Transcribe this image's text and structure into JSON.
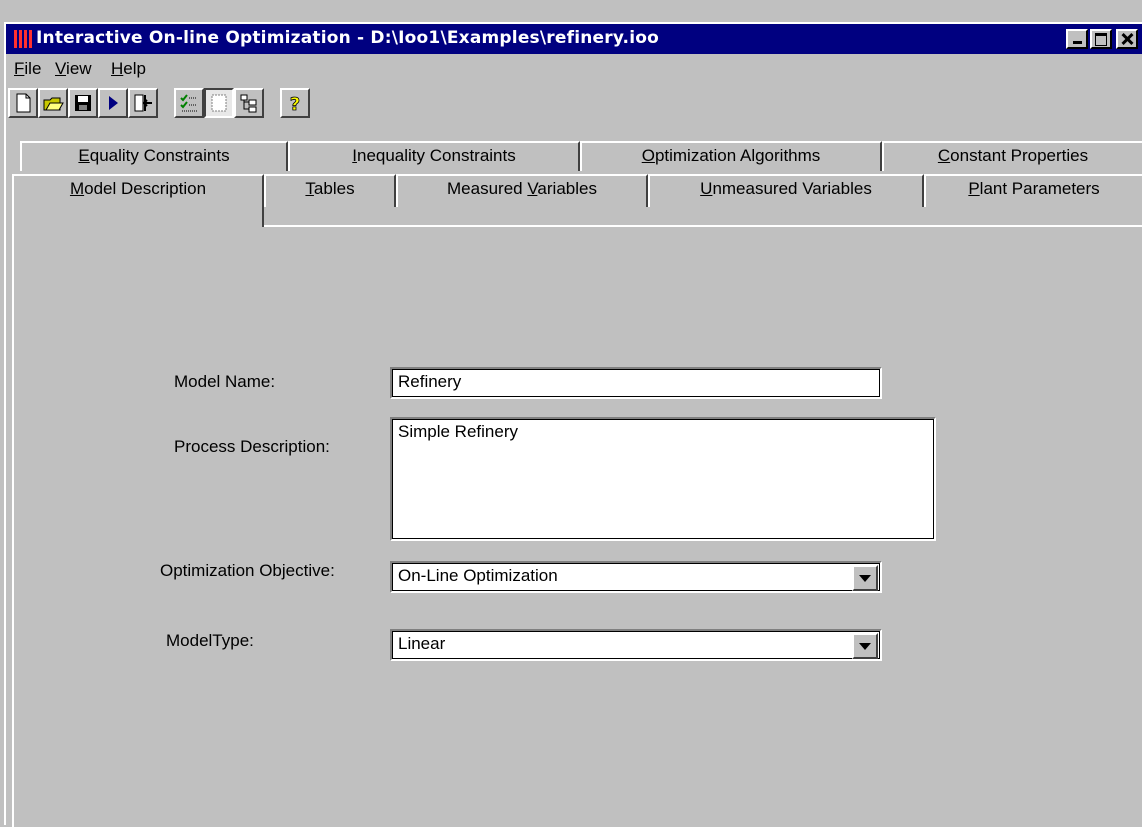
{
  "window": {
    "title": "Interactive On-line Optimization - D:\\Ioo1\\Examples\\refinery.ioo"
  },
  "menu": [
    {
      "label": "File",
      "key": "F",
      "rest": "ile"
    },
    {
      "label": "View",
      "key": "V",
      "rest": "iew"
    },
    {
      "label": "Help",
      "key": "H",
      "rest": "elp"
    }
  ],
  "toolbar": {
    "icons": [
      "new-file-icon",
      "open-folder-icon",
      "save-icon",
      "run-icon",
      "exit-icon",
      "check-list-icon",
      "blank-page-icon",
      "tree-view-icon",
      "help-icon"
    ]
  },
  "tabs": {
    "back_row": [
      {
        "label": "Equality Constraints",
        "key": "E",
        "rest": "quality Constraints"
      },
      {
        "label": "Inequality Constraints",
        "key": "I",
        "rest": "nequality Constraints"
      },
      {
        "label": "Optimization Algorithms",
        "key": "O",
        "rest": "ptimization Algorithms"
      },
      {
        "label": "Constant Properties",
        "key": "C",
        "rest": "onstant Properties"
      }
    ],
    "front_row": [
      {
        "label": "Model Description",
        "key": "M",
        "rest": "odel Description"
      },
      {
        "label": "Tables",
        "key": "T",
        "rest": "ables"
      },
      {
        "label": "Measured Variables",
        "pre": "Measured ",
        "key": "V",
        "rest": "ariables"
      },
      {
        "label": "Unmeasured Variables",
        "key": "U",
        "rest": "nmeasured Variables"
      },
      {
        "label": "Plant Parameters",
        "key": "P",
        "rest": "lant Parameters"
      }
    ],
    "active": "Model Description"
  },
  "form": {
    "model_name_label": "Model Name:",
    "model_name_value": "Refinery",
    "process_description_label": "Process Description:",
    "process_description_value": "Simple Refinery",
    "optimization_objective_label": "Optimization Objective:",
    "optimization_objective_value": "On-Line Optimization",
    "model_type_label": "ModelType:",
    "model_type_value": "Linear"
  },
  "colors": {
    "titlebar": "#000080",
    "face": "#c0c0c0"
  }
}
